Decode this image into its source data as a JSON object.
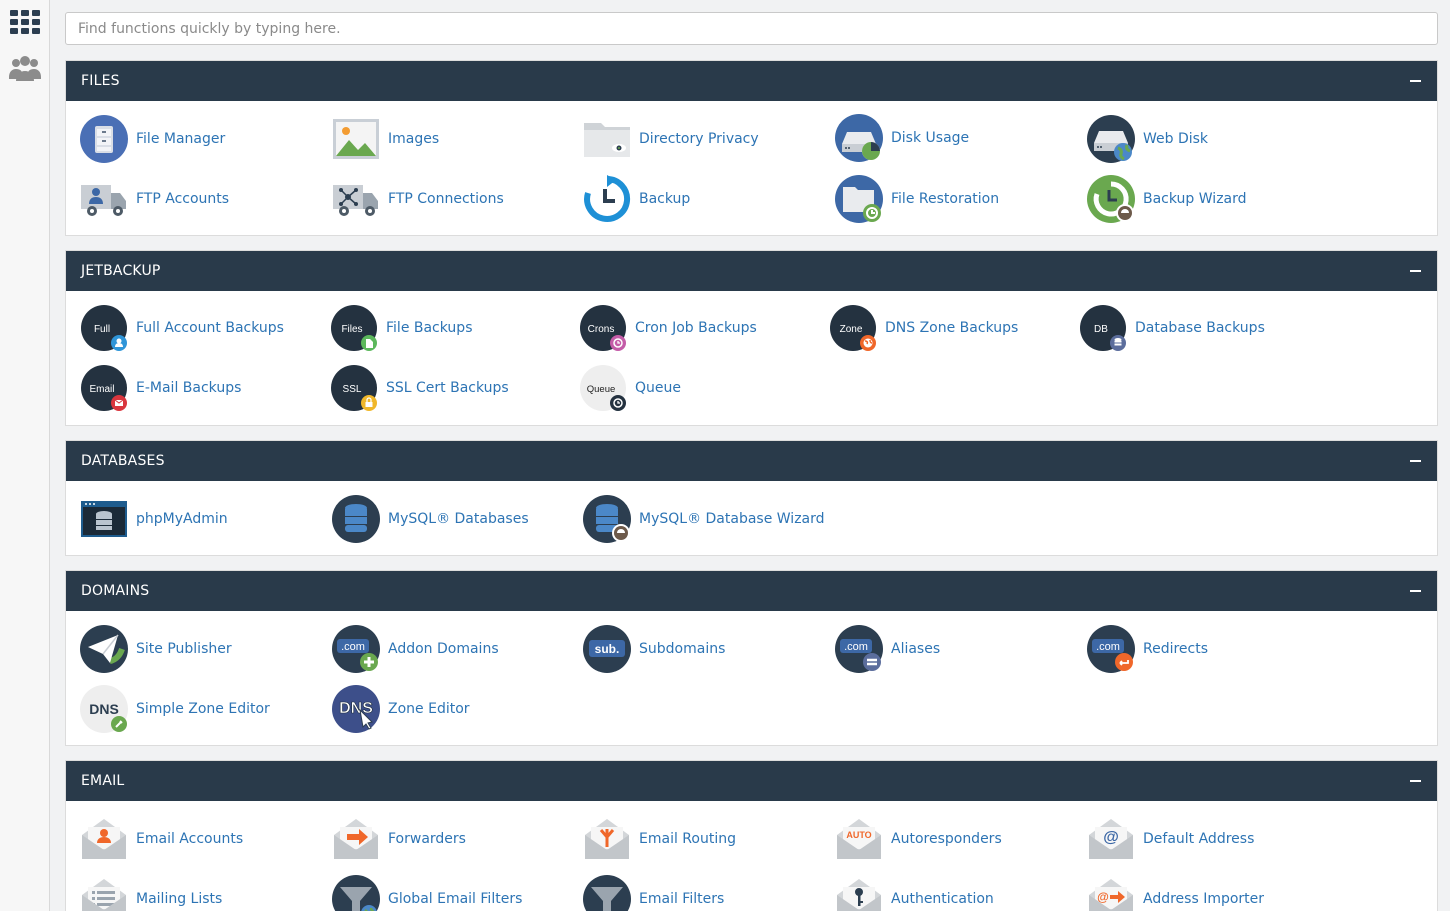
{
  "search": {
    "placeholder": "Find functions quickly by typing here."
  },
  "rail": {
    "items": [
      "apps-grid-icon",
      "users-icon"
    ]
  },
  "colors": {
    "header": "#293a4a",
    "link": "#2d74b4",
    "background": "#f1f2f3"
  },
  "sections": {
    "files": {
      "title": "FILES",
      "items": [
        {
          "label": "File Manager",
          "icon": "file-cabinet-icon"
        },
        {
          "label": "Images",
          "icon": "image-icon"
        },
        {
          "label": "Directory Privacy",
          "icon": "folder-eye-icon"
        },
        {
          "label": "Disk Usage",
          "icon": "hard-drive-pie-icon"
        },
        {
          "label": "Web Disk",
          "icon": "hard-drive-globe-icon"
        },
        {
          "label": "FTP Accounts",
          "icon": "truck-user-icon"
        },
        {
          "label": "FTP Connections",
          "icon": "truck-network-icon"
        },
        {
          "label": "Backup",
          "icon": "backup-clock-icon"
        },
        {
          "label": "File Restoration",
          "icon": "folder-restore-icon"
        },
        {
          "label": "Backup Wizard",
          "icon": "backup-wizard-icon"
        }
      ]
    },
    "jetbackup": {
      "title": "JETBACKUP",
      "items": [
        {
          "label": "Full Account Backups",
          "badge": "Full",
          "icon": "user-badge-icon"
        },
        {
          "label": "File Backups",
          "badge": "Files",
          "icon": "file-badge-icon"
        },
        {
          "label": "Cron Job Backups",
          "badge": "Crons",
          "icon": "clock-badge-icon"
        },
        {
          "label": "DNS Zone Backups",
          "badge": "Zone",
          "icon": "globe-badge-icon"
        },
        {
          "label": "Database Backups",
          "badge": "DB",
          "icon": "database-badge-icon"
        },
        {
          "label": "E-Mail Backups",
          "badge": "Email",
          "icon": "envelope-badge-icon"
        },
        {
          "label": "SSL Cert Backups",
          "badge": "SSL",
          "icon": "lock-badge-icon"
        },
        {
          "label": "Queue",
          "badge": "Queue",
          "icon": "queue-badge-icon"
        }
      ]
    },
    "databases": {
      "title": "DATABASES",
      "items": [
        {
          "label": "phpMyAdmin",
          "icon": "phpmyadmin-icon"
        },
        {
          "label": "MySQL® Databases",
          "icon": "database-icon"
        },
        {
          "label": "MySQL® Database Wizard",
          "icon": "database-wizard-icon"
        }
      ]
    },
    "domains": {
      "title": "DOMAINS",
      "items": [
        {
          "label": "Site Publisher",
          "icon": "paper-plane-icon"
        },
        {
          "label": "Addon Domains",
          "badge": ".com",
          "icon": "domain-add-icon"
        },
        {
          "label": "Subdomains",
          "badge": "sub.",
          "icon": "subdomain-icon"
        },
        {
          "label": "Aliases",
          "badge": ".com",
          "icon": "domain-alias-icon"
        },
        {
          "label": "Redirects",
          "badge": ".com",
          "icon": "domain-redirect-icon"
        },
        {
          "label": "Simple Zone Editor",
          "badge": "DNS",
          "icon": "dns-edit-icon"
        },
        {
          "label": "Zone Editor",
          "badge": "DNS",
          "icon": "dns-cursor-icon"
        }
      ]
    },
    "email": {
      "title": "EMAIL",
      "items": [
        {
          "label": "Email Accounts",
          "icon": "envelope-user-icon"
        },
        {
          "label": "Forwarders",
          "icon": "envelope-arrow-icon"
        },
        {
          "label": "Email Routing",
          "icon": "envelope-routing-icon"
        },
        {
          "label": "Autoresponders",
          "badge": "AUTO",
          "icon": "envelope-auto-icon"
        },
        {
          "label": "Default Address",
          "badge": "@",
          "icon": "envelope-at-icon"
        },
        {
          "label": "Mailing Lists",
          "icon": "mailing-list-icon"
        },
        {
          "label": "Global Email Filters",
          "icon": "funnel-globe-icon"
        },
        {
          "label": "Email Filters",
          "icon": "funnel-icon"
        },
        {
          "label": "Authentication",
          "icon": "envelope-key-icon"
        },
        {
          "label": "Address Importer",
          "badge": "@",
          "icon": "envelope-import-icon"
        }
      ]
    }
  }
}
